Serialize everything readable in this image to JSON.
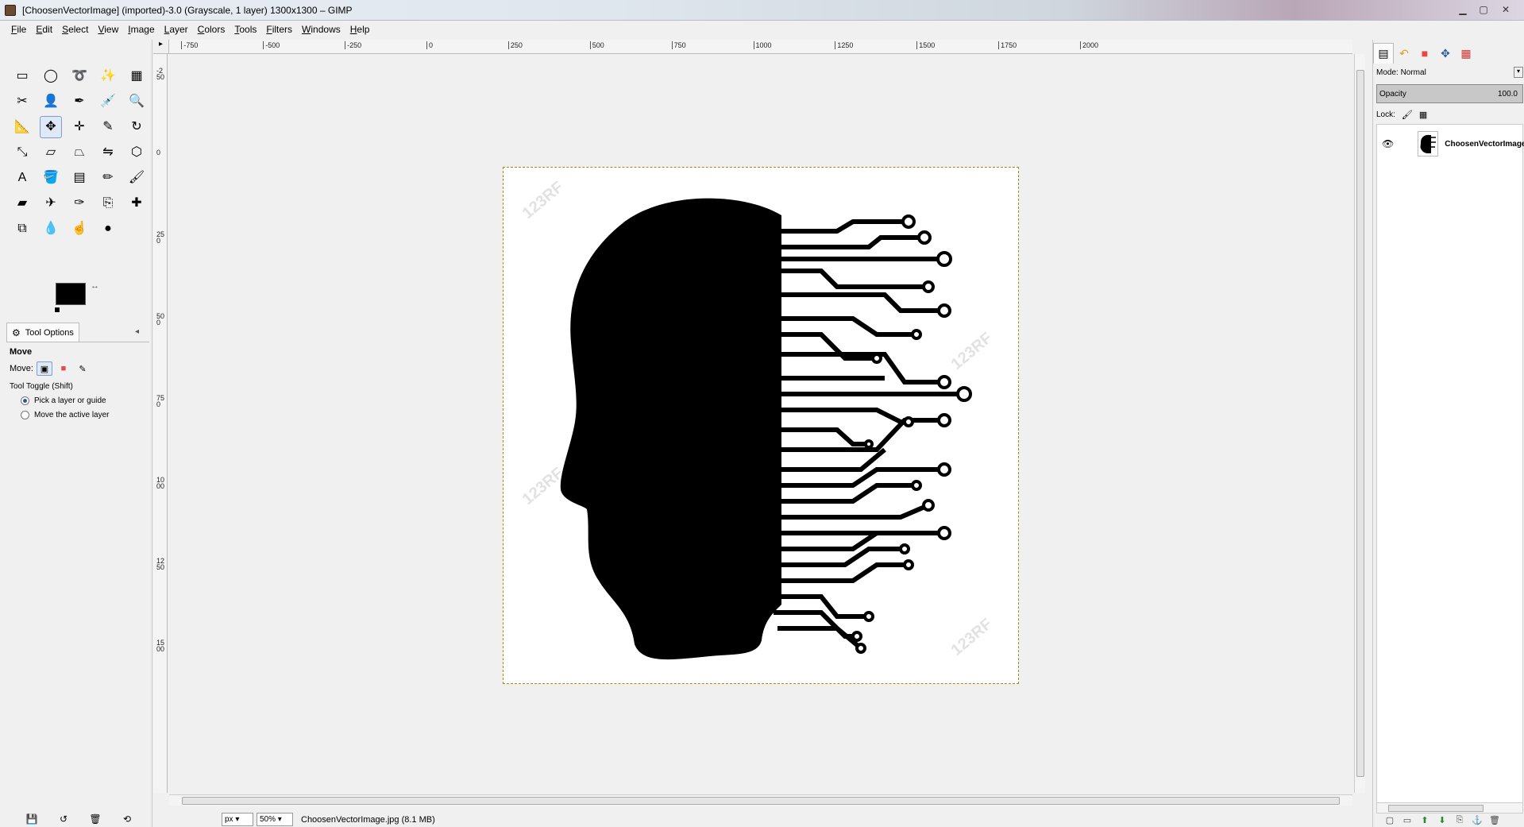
{
  "window": {
    "title": "[ChoosenVectorImage] (imported)-3.0 (Grayscale, 1 layer) 1300x1300 – GIMP",
    "minimize": "▁",
    "maximize": "▢",
    "close": "✕"
  },
  "menu": [
    "File",
    "Edit",
    "Select",
    "View",
    "Image",
    "Layer",
    "Colors",
    "Tools",
    "Filters",
    "Windows",
    "Help"
  ],
  "toolbox": {
    "tools": [
      {
        "name": "rect-select-tool",
        "glyph": "▭"
      },
      {
        "name": "ellipse-select-tool",
        "glyph": "◯"
      },
      {
        "name": "free-select-tool",
        "glyph": "➰"
      },
      {
        "name": "fuzzy-select-tool",
        "glyph": "✨"
      },
      {
        "name": "select-by-color-tool",
        "glyph": "▦"
      },
      {
        "name": "scissors-select-tool",
        "glyph": "✂"
      },
      {
        "name": "foreground-select-tool",
        "glyph": "👤"
      },
      {
        "name": "paths-tool",
        "glyph": "✒"
      },
      {
        "name": "color-picker-tool",
        "glyph": "💉"
      },
      {
        "name": "zoom-tool",
        "glyph": "🔍"
      },
      {
        "name": "measure-tool",
        "glyph": "📐"
      },
      {
        "name": "move-tool",
        "glyph": "✥"
      },
      {
        "name": "align-tool",
        "glyph": "✛"
      },
      {
        "name": "crop-tool",
        "glyph": "✎"
      },
      {
        "name": "rotate-tool",
        "glyph": "↻"
      },
      {
        "name": "scale-tool",
        "glyph": "⤡"
      },
      {
        "name": "shear-tool",
        "glyph": "▱"
      },
      {
        "name": "perspective-tool",
        "glyph": "⏢"
      },
      {
        "name": "flip-tool",
        "glyph": "⇋"
      },
      {
        "name": "cage-transform-tool",
        "glyph": "⬡"
      },
      {
        "name": "text-tool",
        "glyph": "A"
      },
      {
        "name": "bucket-fill-tool",
        "glyph": "🪣"
      },
      {
        "name": "blend-tool",
        "glyph": "▤"
      },
      {
        "name": "pencil-tool",
        "glyph": "✏"
      },
      {
        "name": "paintbrush-tool",
        "glyph": "🖌"
      },
      {
        "name": "eraser-tool",
        "glyph": "▰"
      },
      {
        "name": "airbrush-tool",
        "glyph": "✈"
      },
      {
        "name": "ink-tool",
        "glyph": "✑"
      },
      {
        "name": "clone-tool",
        "glyph": "⎘"
      },
      {
        "name": "heal-tool",
        "glyph": "✚"
      },
      {
        "name": "perspective-clone-tool",
        "glyph": "⧉"
      },
      {
        "name": "blur-sharpen-tool",
        "glyph": "💧"
      },
      {
        "name": "smudge-tool",
        "glyph": "☝"
      },
      {
        "name": "dodge-burn-tool",
        "glyph": "●"
      }
    ],
    "active_tool": "move-tool",
    "swap_glyph": "↔",
    "tab_icon": "⚙",
    "tab_label": "Tool Options",
    "panel_config_glyph": "◂",
    "options": {
      "title": "Move",
      "move_label": "Move:",
      "move_icons": [
        "▣",
        "■",
        "✎"
      ],
      "toggle_label": "Tool Toggle  (Shift)",
      "radio1": "Pick a layer or guide",
      "radio2": "Move the active layer"
    },
    "bottom_icons": [
      "💾",
      "↺",
      "🗑",
      "⟲"
    ]
  },
  "canvas": {
    "corner_glyph": "▸",
    "hruler_labels": [
      {
        "text": "-750",
        "val": -750
      },
      {
        "text": "-500",
        "val": -500
      },
      {
        "text": "-250",
        "val": -250
      },
      {
        "text": "0",
        "val": 0
      },
      {
        "text": "250",
        "val": 250
      },
      {
        "text": "500",
        "val": 500
      },
      {
        "text": "750",
        "val": 750
      },
      {
        "text": "1000",
        "val": 1000
      },
      {
        "text": "1250",
        "val": 1250
      },
      {
        "text": "1500",
        "val": 1500
      },
      {
        "text": "1750",
        "val": 1750
      },
      {
        "text": "2000",
        "val": 2000
      }
    ],
    "vruler_labels": [
      {
        "text": "-250",
        "val": -250
      },
      {
        "text": "0",
        "val": 0
      },
      {
        "text": "250",
        "val": 250
      },
      {
        "text": "500",
        "val": 500
      },
      {
        "text": "750",
        "val": 750
      },
      {
        "text": "1000",
        "val": 1000
      },
      {
        "text": "1250",
        "val": 1250
      },
      {
        "text": "1500",
        "val": 1500
      }
    ],
    "watermark": "123RF"
  },
  "statusbar": {
    "unit": "px ▾",
    "zoom": "50% ▾",
    "file": "ChoosenVectorImage.jpg (8.1 MB)"
  },
  "dock": {
    "tabs": [
      "▤",
      "↶",
      "■",
      "✥",
      "▦"
    ],
    "mode_label": "Mode: Normal",
    "mode_dd": "▾",
    "opacity_label": "Opacity",
    "opacity_value": "100.0",
    "lock_label": "Lock:",
    "lock_icons": [
      "🖌",
      "▦"
    ],
    "layer": {
      "eye": "👁",
      "name": "ChoosenVectorImage"
    },
    "bottom_icons": [
      "▢",
      "▭",
      "⬆",
      "⬇",
      "⎘",
      "⚓",
      "🗑"
    ]
  }
}
